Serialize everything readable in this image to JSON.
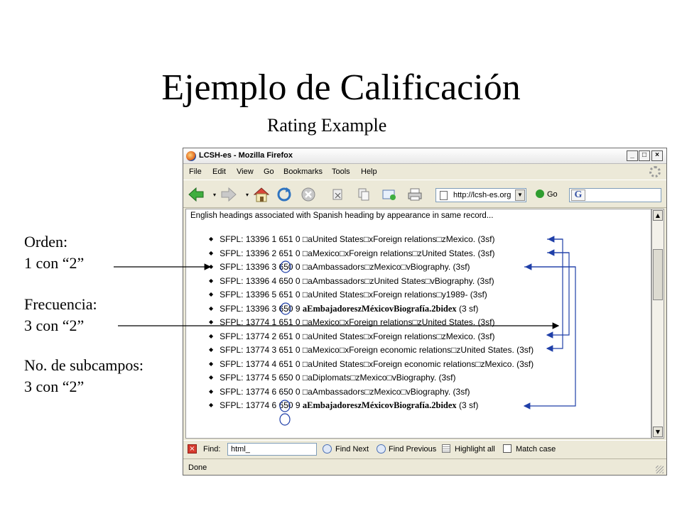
{
  "slide": {
    "title": "Ejemplo de Calificación",
    "subtitle": "Rating Example"
  },
  "notes": [
    {
      "line1": "Orden:",
      "line2": "1 con “2”"
    },
    {
      "line1": "Frecuencia:",
      "line2": "3 con “2”"
    },
    {
      "line1": "No. de subcampos:",
      "line2": "3 con “2”"
    }
  ],
  "window": {
    "title": "LCSH-es - Mozilla Firefox",
    "controls": {
      "minimize": "_",
      "maximize": "□",
      "close": "×"
    }
  },
  "menu": {
    "file": "File",
    "edit": "Edit",
    "view": "View",
    "go": "Go",
    "bookmarks": "Bookmarks",
    "tools": "Tools",
    "help": "Help"
  },
  "toolbar": {
    "url": "http://lcsh-es.org",
    "go_label": "Go",
    "search_engine": "G"
  },
  "content": {
    "intro": "English headings associated with Spanish heading by appearance in same record...",
    "records": [
      {
        "prefix": "SFPL: 13396 1 651 0 ",
        "text": "□aUnited States□xForeign relations□zMexico. (3sf)",
        "bold": ""
      },
      {
        "prefix": "SFPL: 13396 2 651 0 ",
        "text": "□aMexico□xForeign relations□zUnited States. (3sf)",
        "bold": ""
      },
      {
        "prefix": "SFPL: 13396 3 650 0 ",
        "text": "□aAmbassadors□zMexico□vBiography. (3sf)",
        "bold": ""
      },
      {
        "prefix": "SFPL: 13396 4 650 0 ",
        "text": "□aAmbassadors□zUnited States□vBiography. (3sf)",
        "bold": ""
      },
      {
        "prefix": "SFPL: 13396 5 651 0 ",
        "text": "□aUnited States□xForeign relations□y1989- (3sf)",
        "bold": ""
      },
      {
        "prefix": "SFPL: 13396 3 650 9 ",
        "text": " (3 sf)",
        "bold": "aEmbajadoreszMéxicovBiografía.2bidex"
      },
      {
        "prefix": "SFPL: 13774 1 651 0 ",
        "text": "□aMexico□xForeign relations□zUnited States. (3sf)",
        "bold": ""
      },
      {
        "prefix": "SFPL: 13774 2 651 0 ",
        "text": "□aUnited States□xForeign relations□zMexico. (3sf)",
        "bold": ""
      },
      {
        "prefix": "SFPL: 13774 3 651 0 ",
        "text": "□aMexico□xForeign economic relations□zUnited States. (3sf)",
        "bold": ""
      },
      {
        "prefix": "SFPL: 13774 4 651 0 ",
        "text": "□aUnited States□xForeign economic relations□zMexico. (3sf)",
        "bold": ""
      },
      {
        "prefix": "SFPL: 13774 5 650 0 ",
        "text": "□aDiplomats□zMexico□vBiography. (3sf)",
        "bold": ""
      },
      {
        "prefix": "SFPL: 13774 6 650 0 ",
        "text": "□aAmbassadors□zMexico□vBiography. (3sf)",
        "bold": ""
      },
      {
        "prefix": "SFPL: 13774 6 650 9 ",
        "text": " (3 sf)",
        "bold": "aEmbajadoreszMéxicovBiografía.2bidex"
      }
    ]
  },
  "findbar": {
    "label": "Find:",
    "value": "html_",
    "next": "Find Next",
    "previous": "Find Previous",
    "highlight": "Highlight all",
    "match_case": "Match case"
  },
  "status": {
    "text": "Done"
  },
  "colors": {
    "arrow": "#1f3fa8",
    "circle": "#1f3fa8"
  }
}
